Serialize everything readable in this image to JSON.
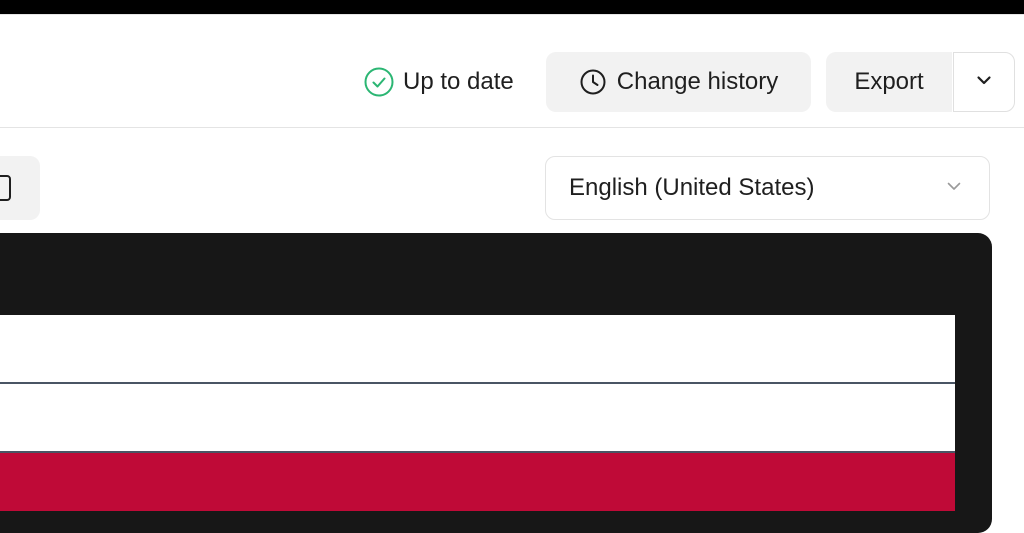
{
  "header": {
    "status_text": "Up to date",
    "change_history_label": "Change history",
    "export_label": "Export"
  },
  "language": {
    "selected": "English (United States)"
  },
  "colors": {
    "status_green": "#2bb673",
    "preview_frame": "#171717",
    "brand_red": "#bf0a37",
    "stripe_line": "#4a5564"
  },
  "icons": {
    "status": "check-circle-icon",
    "history": "clock-icon",
    "export_menu": "chevron-down-icon",
    "language_menu": "chevron-down-icon",
    "left_tool": "device-icon"
  }
}
